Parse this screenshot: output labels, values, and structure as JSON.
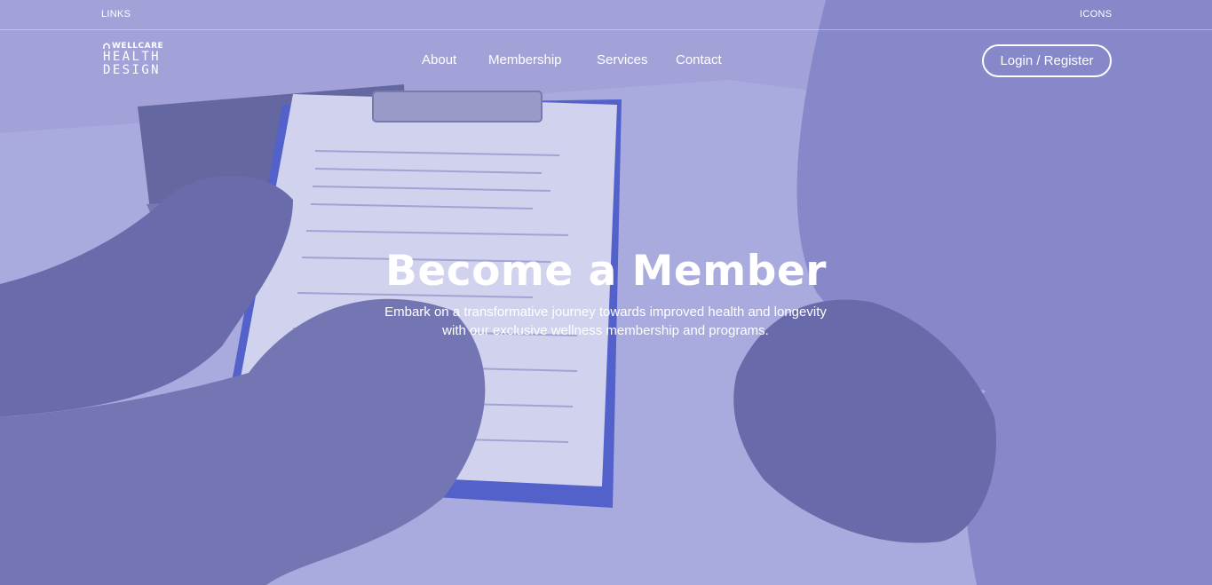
{
  "topbar": {
    "left_label": "LINKS",
    "right_label": "ICONS"
  },
  "logo": {
    "line1": "WELLCARE",
    "line2": "HEALTH",
    "line3": "DESIGN"
  },
  "nav": {
    "items": [
      {
        "label": "About"
      },
      {
        "label": "Membership"
      },
      {
        "label": "Services"
      },
      {
        "label": "Contact"
      }
    ]
  },
  "auth": {
    "button_label": "Login / Register"
  },
  "hero": {
    "title": "Become a Member",
    "subtitle_line1": "Embark on a transformative journey towards improved health and longevity",
    "subtitle_line2": "with our exclusive wellness membership and programs."
  },
  "colors": {
    "overlay": "#8e8fd0",
    "text": "#ffffff",
    "paper": "#e8e9f8",
    "clipboard": "#3c4fc9"
  }
}
